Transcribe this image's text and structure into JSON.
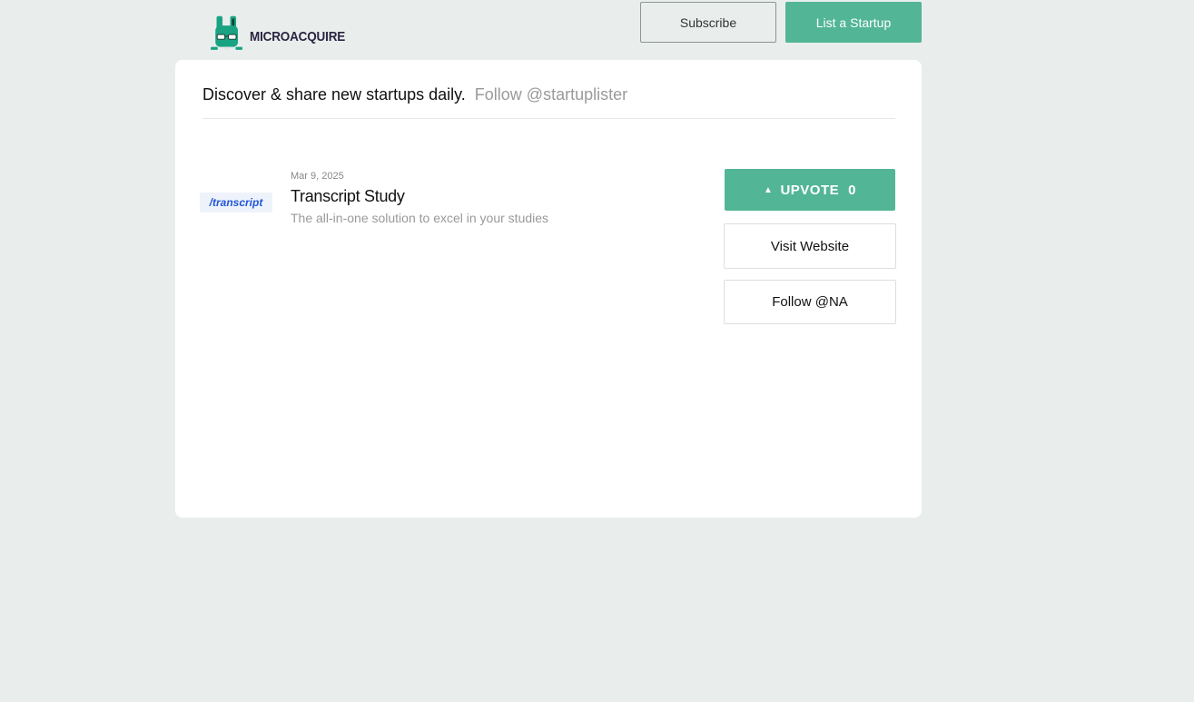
{
  "brand": {
    "name": "MICROACQUIRE"
  },
  "nav": {
    "subscribe_label": "Subscribe",
    "list_label": "List a Startup"
  },
  "header": {
    "tagline": "Discover & share new startups daily.",
    "follow": "Follow @startuplister"
  },
  "listing": {
    "thumb_text": "/transcript",
    "date": "Mar 9, 2025",
    "title": "Transcript Study",
    "description": "The all-in-one solution to excel in your studies",
    "upvote_label": "UPVOTE",
    "upvote_count": "0",
    "visit_label": "Visit Website",
    "follow_label": "Follow @NA"
  },
  "colors": {
    "accent": "#52b596",
    "background": "#e9eeed"
  }
}
